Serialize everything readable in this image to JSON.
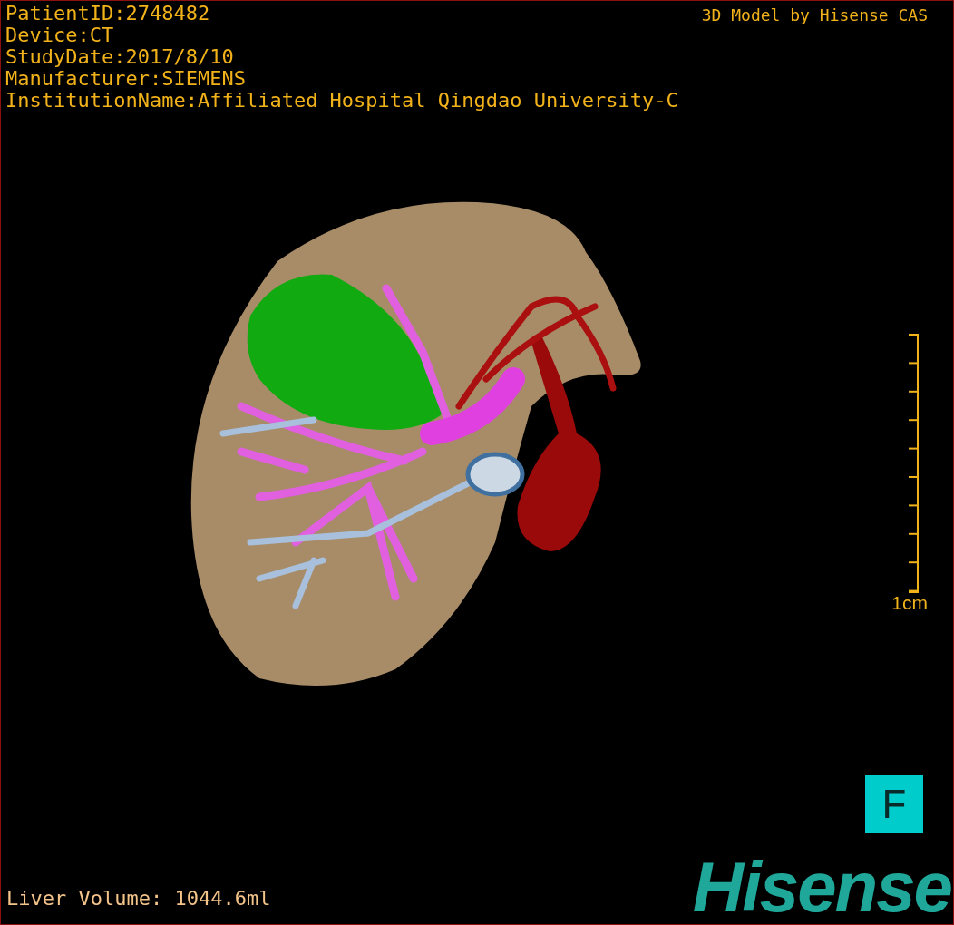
{
  "info_lines": [
    "PatientID:2748482",
    "Device:CT",
    "StudyDate:2017/8/10",
    "Manufacturer:SIEMENS",
    "InstitutionName:Affiliated Hospital Qingdao University-C"
  ],
  "header": "3D Model by Hisense CAS",
  "scale_bar": {
    "label": "1cm"
  },
  "orientation_marker": "F",
  "volume": "Liver Volume: 1044.6ml",
  "logo": "Hisense"
}
